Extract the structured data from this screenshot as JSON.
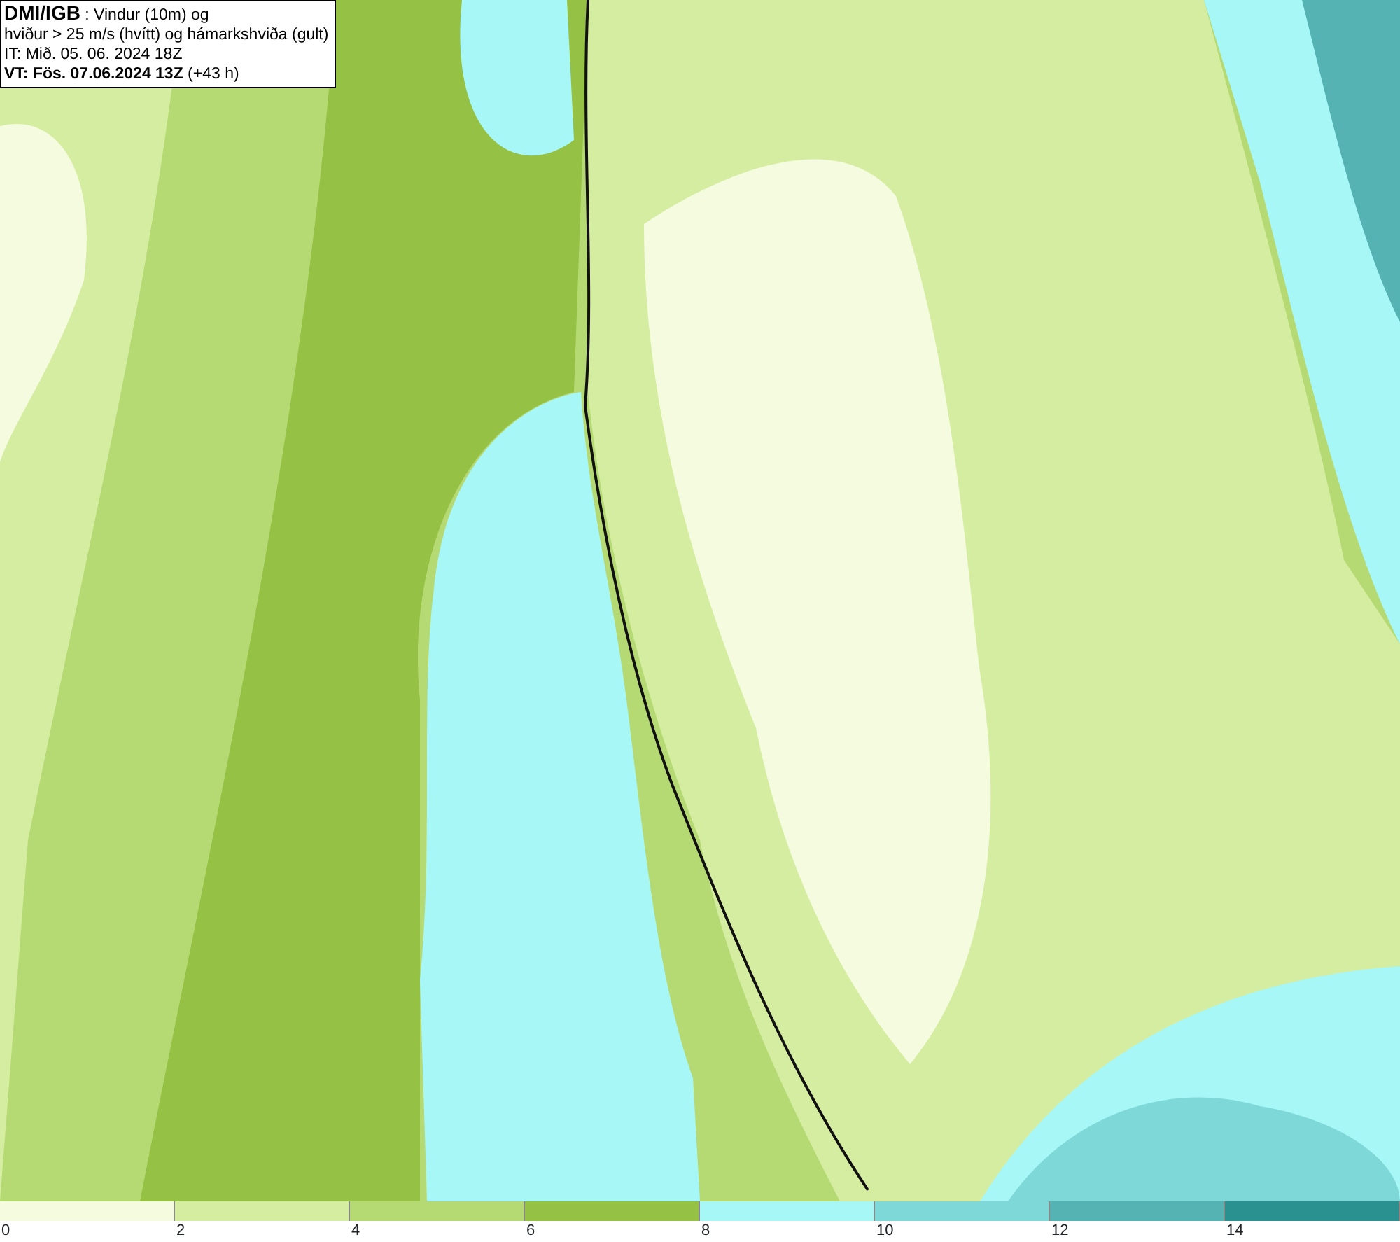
{
  "header": {
    "lines": [
      "**DMI/IGB** : Vindur (10m) og",
      "hviður > 25 m/s (hvítt) og hámarkshviða (gult)",
      "IT: Mið. 05. 06. 2024 18Z",
      "**VT: Fös. 07.06.2024 13Z** (+43 h)"
    ]
  },
  "legend": {
    "segments": [
      {
        "color": "#f5fbdf"
      },
      {
        "color": "#d5eda0"
      },
      {
        "color": "#b5da74"
      },
      {
        "color": "#95c145"
      },
      {
        "color": "#a8f7f7"
      },
      {
        "color": "#7ed8d8"
      },
      {
        "color": "#55b3b3"
      },
      {
        "color": "#2a9090"
      }
    ],
    "ticks": [
      "0",
      "2",
      "4",
      "6",
      "8",
      "10",
      "12",
      "14"
    ]
  }
}
